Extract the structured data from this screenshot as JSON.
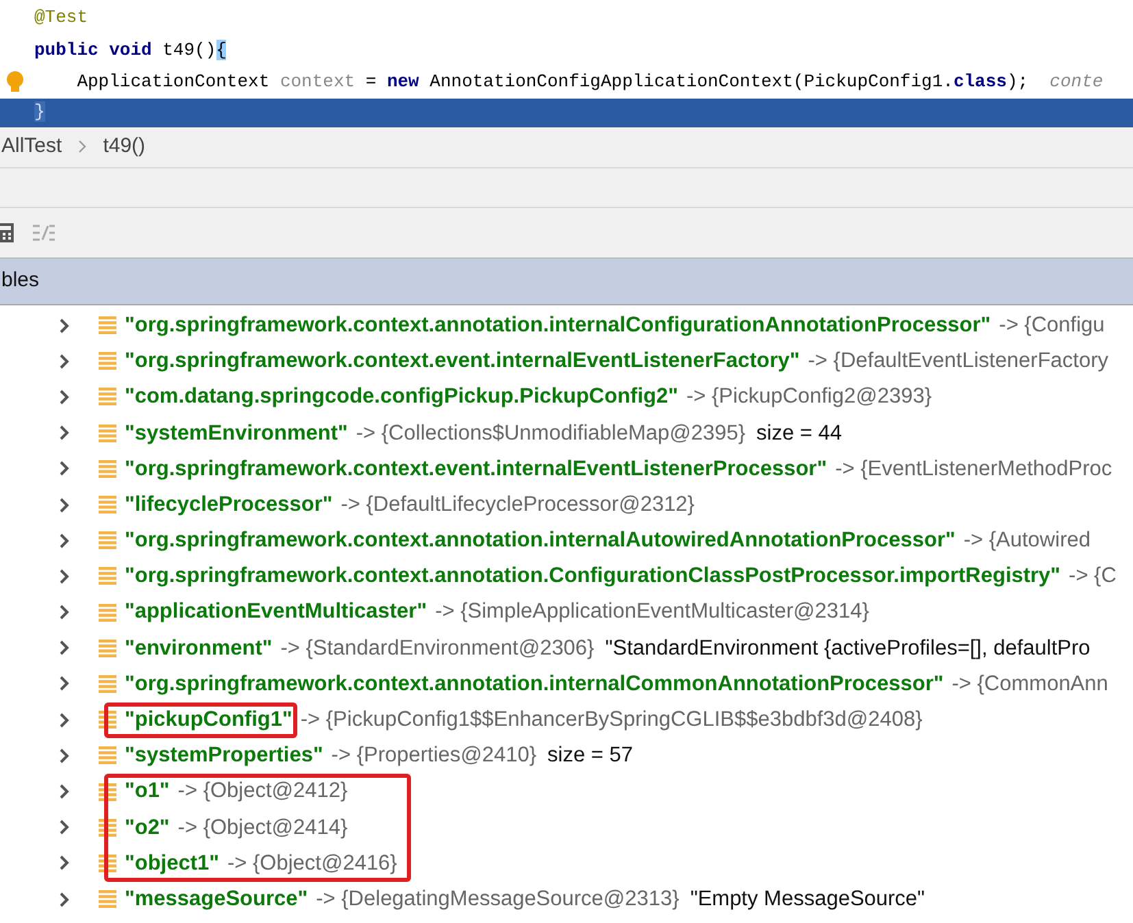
{
  "editor": {
    "lines": [
      {
        "kind": "code",
        "tokens": [
          {
            "kind": "annotation",
            "text": "@Test"
          }
        ]
      },
      {
        "kind": "code",
        "tokens": [
          {
            "kind": "keyword",
            "text": "public void"
          },
          {
            "kind": "plain",
            "text": " t49()"
          },
          {
            "kind": "brace",
            "text": "{"
          }
        ]
      },
      {
        "kind": "code",
        "bulb": true,
        "tokens": [
          {
            "kind": "plain",
            "text": "    ApplicationContext "
          },
          {
            "kind": "local",
            "text": "context"
          },
          {
            "kind": "plain",
            "text": " = "
          },
          {
            "kind": "keyword",
            "text": "new"
          },
          {
            "kind": "plain",
            "text": " AnnotationConfigApplicationContext(PickupConfig1."
          },
          {
            "kind": "keyword",
            "text": "class"
          },
          {
            "kind": "plain",
            "text": ");  "
          },
          {
            "kind": "hint",
            "text": "conte"
          }
        ]
      },
      {
        "kind": "execution_point",
        "tokens": [
          {
            "kind": "brace",
            "text": "}"
          }
        ]
      }
    ]
  },
  "breadcrumb": [
    "AllTest",
    "t49()"
  ],
  "panel_header": "bles",
  "variables": [
    {
      "key": "\"org.springframework.context.annotation.internalConfigurationAnnotationProcessor\"",
      "value": "-> {Configu",
      "boxed": false
    },
    {
      "key": "\"org.springframework.context.event.internalEventListenerFactory\"",
      "value": "-> {DefaultEventListenerFactory",
      "boxed": false
    },
    {
      "key": "\"com.datang.springcode.configPickup.PickupConfig2\"",
      "value": "-> {PickupConfig2@2393}",
      "boxed": false
    },
    {
      "key": "\"systemEnvironment\"",
      "value": "-> {Collections$UnmodifiableMap@2395}",
      "extra": "size = 44",
      "boxed": false
    },
    {
      "key": "\"org.springframework.context.event.internalEventListenerProcessor\"",
      "value": "-> {EventListenerMethodProc",
      "boxed": false
    },
    {
      "key": "\"lifecycleProcessor\"",
      "value": "-> {DefaultLifecycleProcessor@2312}",
      "boxed": false
    },
    {
      "key": "\"org.springframework.context.annotation.internalAutowiredAnnotationProcessor\"",
      "value": "-> {Autowired",
      "boxed": false
    },
    {
      "key": "\"org.springframework.context.annotation.ConfigurationClassPostProcessor.importRegistry\"",
      "value": "-> {C",
      "boxed": false
    },
    {
      "key": "\"applicationEventMulticaster\"",
      "value": "-> {SimpleApplicationEventMulticaster@2314}",
      "boxed": false
    },
    {
      "key": "\"environment\"",
      "value": "-> {StandardEnvironment@2306}",
      "extra": "\"StandardEnvironment {activeProfiles=[], defaultPro",
      "boxed": false
    },
    {
      "key": "\"org.springframework.context.annotation.internalCommonAnnotationProcessor\"",
      "value": "-> {CommonAnn",
      "boxed": false
    },
    {
      "key": "\"pickupConfig1\"",
      "value": "-> {PickupConfig1$$EnhancerBySpringCGLIB$$e3bdbf3d@2408}",
      "boxed": true
    },
    {
      "key": "\"systemProperties\"",
      "value": "-> {Properties@2410}",
      "extra": "size = 57",
      "boxed": false
    },
    {
      "key": "\"o1\"",
      "value": "-> {Object@2412}",
      "boxed": true
    },
    {
      "key": "\"o2\"",
      "value": "-> {Object@2414}",
      "boxed": true
    },
    {
      "key": "\"object1\"",
      "value": "-> {Object@2416}",
      "boxed": true
    },
    {
      "key": "\"messageSource\"",
      "value": "-> {DelegatingMessageSource@2313}",
      "extra": "\"Empty MessageSource\"",
      "boxed": false
    }
  ]
}
